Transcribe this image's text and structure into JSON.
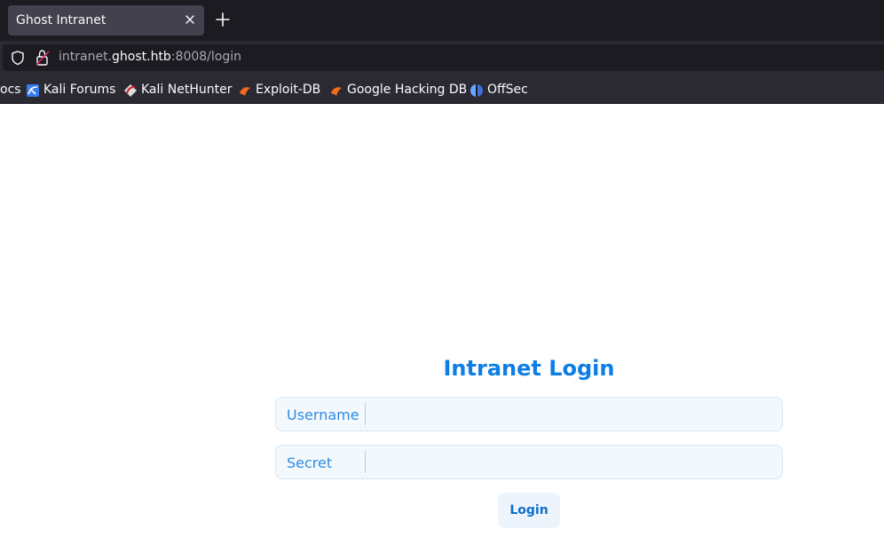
{
  "browser": {
    "tab": {
      "title": "Ghost Intranet"
    },
    "url": {
      "prefix": "intranet.",
      "host": "ghost.htb",
      "suffix": ":8008/login"
    },
    "bookmarks": [
      {
        "label": "ocs",
        "icon": "none"
      },
      {
        "label": "Kali Forums",
        "icon": "kali-forums-icon"
      },
      {
        "label": "Kali NetHunter",
        "icon": "kali-nethunter-icon"
      },
      {
        "label": "Exploit-DB",
        "icon": "exploit-db-icon"
      },
      {
        "label": "Google Hacking DB",
        "icon": "ghdb-icon"
      },
      {
        "label": "OffSec",
        "icon": "offsec-icon"
      }
    ]
  },
  "login": {
    "title": "Intranet Login",
    "username_label": "Username",
    "secret_label": "Secret",
    "button_label": "Login"
  },
  "colors": {
    "accent": "#0d7ee6",
    "field_bg": "#f3f8fd"
  }
}
